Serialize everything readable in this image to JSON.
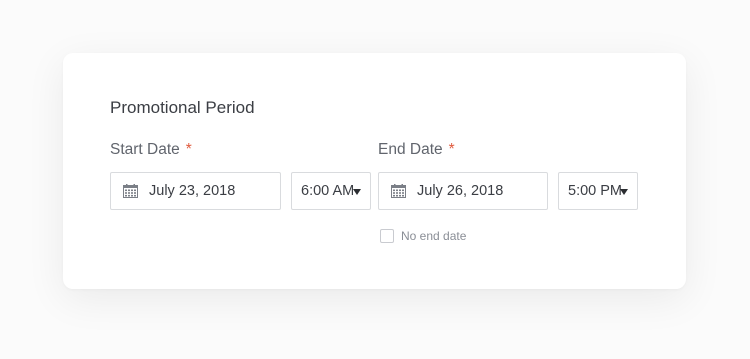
{
  "section": {
    "title": "Promotional Period"
  },
  "start": {
    "label": "Start Date",
    "required_marker": "*",
    "date_value": "July 23, 2018",
    "time_value": "6:00 AM"
  },
  "end": {
    "label": "End Date",
    "required_marker": "*",
    "date_value": "July 26, 2018",
    "time_value": "5:00 PM"
  },
  "no_end_date": {
    "label": "No end date",
    "checked": false
  },
  "colors": {
    "required": "#e0593c",
    "border": "#d9dbde",
    "text": "#3b3e44",
    "muted": "#8a8e96"
  },
  "icons": {
    "date_field": "calendar-icon",
    "time_field": "caret-down-icon"
  }
}
